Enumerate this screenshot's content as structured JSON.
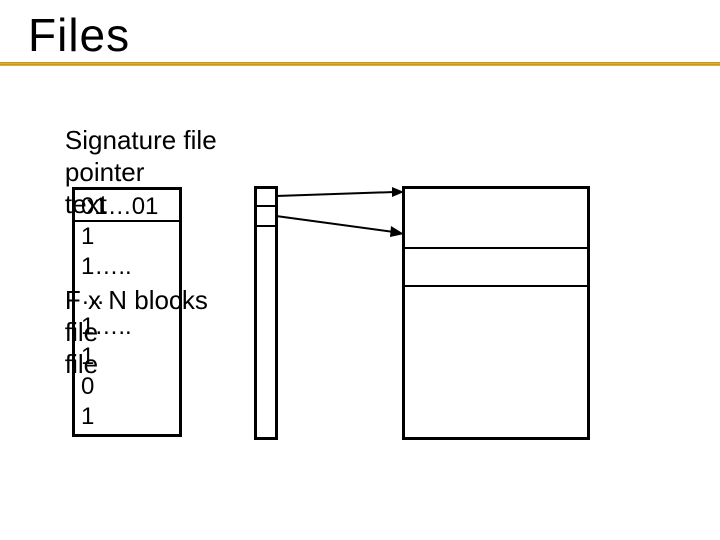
{
  "title": "Files",
  "labels": {
    "row1": {
      "c1": "Signature file",
      "c2": "pointer",
      "c3": "text"
    },
    "row2": {
      "c1": "F x N blocks",
      "c2": "file",
      "c3": "file"
    }
  },
  "signature_rows": [
    "01…01",
    "1",
    "1…..",
    "…",
    "1…..",
    "1",
    "0",
    "1"
  ],
  "colors": {
    "rule": "#d7b23a"
  }
}
